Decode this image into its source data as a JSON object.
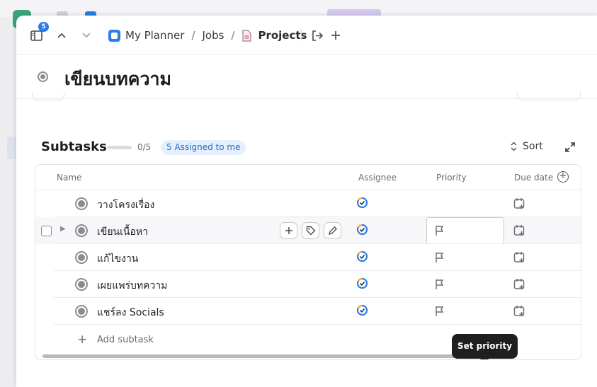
{
  "topbar": {
    "notification_count": "5",
    "breadcrumbs": [
      "My Planner",
      "Jobs",
      "Projects"
    ]
  },
  "task": {
    "title": "เขียนบทความ"
  },
  "subtasks": {
    "heading": "Subtasks",
    "progress_text": "0/5",
    "progress_fraction": 0,
    "assigned_badge": "5 Assigned to me",
    "sort_label": "Sort",
    "columns": {
      "name": "Name",
      "assignee": "Assignee",
      "priority": "Priority",
      "due_date": "Due date"
    },
    "rows": [
      {
        "name": "วางโครงเรื่อง"
      },
      {
        "name": "เขียนเนื้อหา"
      },
      {
        "name": "แก้ไขงาน"
      },
      {
        "name": "เผยแพร่บทความ"
      },
      {
        "name": "แชร์ลง Socials"
      }
    ],
    "add_label": "Add subtask",
    "priority_tooltip": "Set priority"
  },
  "colors": {
    "accent": "#2b7de9",
    "badge_bg": "#e6f0fc",
    "badge_text": "#1f6fd6",
    "tooltip_bg": "#1f1f22"
  }
}
